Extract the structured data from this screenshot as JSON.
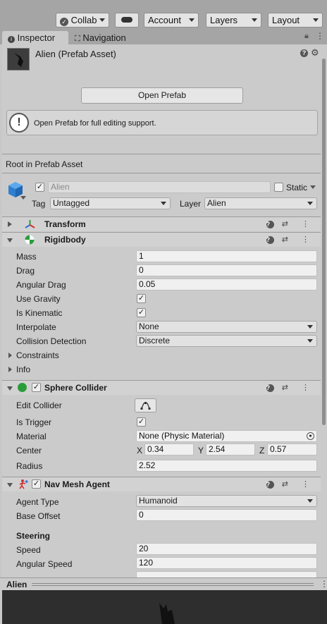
{
  "toolbar": {
    "collab": "Collab",
    "account": "Account",
    "layers": "Layers",
    "layout": "Layout"
  },
  "tabs": {
    "inspector": "Inspector",
    "navigation": "Navigation"
  },
  "asset": {
    "title": "Alien (Prefab Asset)",
    "open_prefab": "Open Prefab",
    "notice": "Open Prefab for full editing support.",
    "root_label": "Root in Prefab Asset"
  },
  "gameobject": {
    "name": "Alien",
    "static_label": "Static",
    "tag_label": "Tag",
    "tag_value": "Untagged",
    "layer_label": "Layer",
    "layer_value": "Alien"
  },
  "transform": {
    "title": "Transform"
  },
  "rigidbody": {
    "title": "Rigidbody",
    "mass_label": "Mass",
    "mass": "1",
    "drag_label": "Drag",
    "drag": "0",
    "angular_drag_label": "Angular Drag",
    "angular_drag": "0.05",
    "use_gravity_label": "Use Gravity",
    "is_kinematic_label": "Is Kinematic",
    "interpolate_label": "Interpolate",
    "interpolate": "None",
    "collision_label": "Collision Detection",
    "collision": "Discrete",
    "constraints_label": "Constraints",
    "info_label": "Info"
  },
  "sphere_collider": {
    "title": "Sphere Collider",
    "edit_label": "Edit Collider",
    "trigger_label": "Is Trigger",
    "material_label": "Material",
    "material": "None (Physic Material)",
    "center_label": "Center",
    "x_label": "X",
    "x": "0.34",
    "y_label": "Y",
    "y": "2.54",
    "z_label": "Z",
    "z": "0.57",
    "radius_label": "Radius",
    "radius": "2.52"
  },
  "nav_mesh_agent": {
    "title": "Nav Mesh Agent",
    "agent_type_label": "Agent Type",
    "agent_type": "Humanoid",
    "base_offset_label": "Base Offset",
    "base_offset": "0",
    "steering_label": "Steering",
    "speed_label": "Speed",
    "speed": "20",
    "angular_speed_label": "Angular Speed",
    "angular_speed": "120"
  },
  "preview": {
    "title": "Alien"
  }
}
